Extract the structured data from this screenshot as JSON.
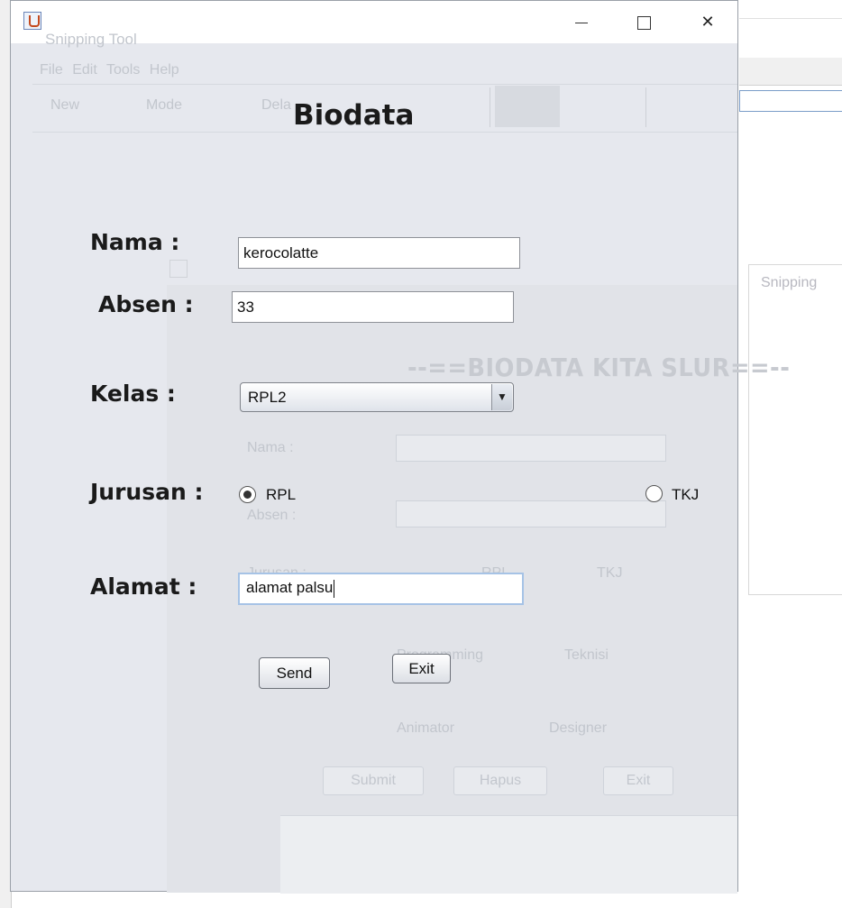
{
  "background": {
    "ghost_window_title": "Snipping Tool",
    "ghost_menu": [
      "File",
      "Edit",
      "Tools",
      "Help"
    ],
    "ghost_toolbar": {
      "new": "New",
      "mode": "Mode",
      "delay": "Dela"
    },
    "right_window_title": "Snipping",
    "ghost_form": {
      "heading": "--==BIODATA KITA SLUR==--",
      "nama_label": "Nama    :",
      "absen_label": "Absen   :",
      "jurusan_label": "Jurusan  :",
      "rpl": "RPL",
      "tkj": "TKJ",
      "programming": "Programming",
      "teknisi": "Teknisi",
      "animator": "Animator",
      "designer": "Designer",
      "submit": "Submit",
      "hapus": "Hapus",
      "exit": "Exit"
    }
  },
  "window": {
    "icon": "java-icon",
    "controls": {
      "minimize": "minimize-icon",
      "maximize": "maximize-icon",
      "close": "✕"
    }
  },
  "form": {
    "title": "Biodata",
    "nama_label": "Nama  :",
    "nama_value": "kerocolatte",
    "absen_label": "Absen :",
    "absen_value": "33",
    "kelas_label": "Kelas  :",
    "kelas_selected": "RPL2",
    "jurusan_label": "Jurusan :",
    "jurusan_options": [
      "RPL",
      "TKJ"
    ],
    "jurusan_selected": "RPL",
    "alamat_label": "Alamat :",
    "alamat_value": "alamat palsu",
    "send_label": "Send",
    "exit_label": "Exit"
  }
}
